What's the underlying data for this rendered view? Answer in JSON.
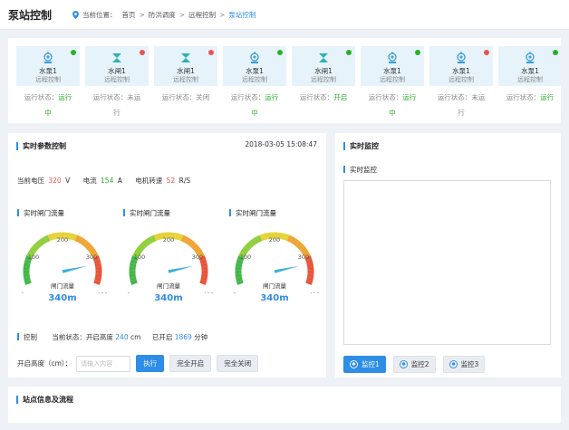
{
  "header": {
    "title": "泵站控制",
    "breadcrumb_label": "当前位置：",
    "breadcrumb": [
      "首页",
      "防洪调度",
      "远程控制",
      "泵站控制"
    ]
  },
  "pumps": [
    {
      "name": "水泵1",
      "sub": "远程控制",
      "status_label": "运行状态：",
      "status_a": "运行",
      "status_b": "中",
      "status_color": "green",
      "dot": "#2bae2b",
      "icon": "pump-icon"
    },
    {
      "name": "水闸1",
      "sub": "远程控制",
      "status_label": "运行状态：",
      "status_a": "未运",
      "status_b": "行",
      "status_color": "gray",
      "dot": "#e8554e",
      "icon": "sluice-gate-icon"
    },
    {
      "name": "水闸1",
      "sub": "远程控制",
      "status_label": "运行状态：",
      "status_a": "关闭",
      "status_b": "",
      "status_color": "gray",
      "dot": "#e8554e",
      "icon": "sluice-gate-icon"
    },
    {
      "name": "水泵1",
      "sub": "远程控制",
      "status_label": "运行状态：",
      "status_a": "运行",
      "status_b": "中",
      "status_color": "green",
      "dot": "#2bae2b",
      "icon": "pump-icon"
    },
    {
      "name": "水闸1",
      "sub": "远程控制",
      "status_label": "运行状态：",
      "status_a": "开启",
      "status_b": "",
      "status_color": "green",
      "dot": "#2bae2b",
      "icon": "sluice-gate-icon"
    },
    {
      "name": "水泵1",
      "sub": "远程控制",
      "status_label": "运行状态：",
      "status_a": "运行",
      "status_b": "中",
      "status_color": "green",
      "dot": "#2bae2b",
      "icon": "pump-icon"
    },
    {
      "name": "水泵1",
      "sub": "远程控制",
      "status_label": "运行状态：",
      "status_a": "未运",
      "status_b": "行",
      "status_color": "gray",
      "dot": "#e8554e",
      "icon": "pump-icon"
    },
    {
      "name": "水泵1",
      "sub": "远程控制",
      "status_label": "运行状态：",
      "status_a": "运行",
      "status_b": "",
      "status_color": "green",
      "dot": "#2bae2b",
      "icon": "pump-icon"
    }
  ],
  "params": {
    "title": "实时参数控制",
    "timestamp": "2018-03-05 15:08:47",
    "voltage_label": "当前电压",
    "voltage_value": "320",
    "voltage_unit": "V",
    "current_label": "电流",
    "current_value": "154",
    "current_unit": "A",
    "speed_label": "电机转速",
    "speed_value": "52",
    "speed_unit": "R/S",
    "gauges": [
      {
        "title": "实时闸门流量",
        "label": "闸门流量",
        "value": "340m",
        "reading": 340
      },
      {
        "title": "实时闸门流量",
        "label": "闸门流量",
        "value": "340m",
        "reading": 340
      },
      {
        "title": "实时闸门流量",
        "label": "闸门流量",
        "value": "340m",
        "reading": 340
      }
    ],
    "gauge_ticks": [
      "0",
      "100",
      "200",
      "300",
      "400"
    ],
    "control_label": "控制",
    "state_label": "当前状态：开启高度",
    "height_value": "240",
    "height_unit": "cm",
    "opened_label": "已开启",
    "opened_value": "1869",
    "opened_unit": "分钟",
    "open_height_label": "开启高度（cm）：",
    "input_placeholder": "请输入内容",
    "execute_btn": "执行",
    "full_open_btn": "完全开启",
    "full_close_btn": "完全关闭"
  },
  "monitor": {
    "title": "实时监控",
    "sub_title": "实时监控",
    "tabs": [
      "监控1",
      "监控2",
      "监控3"
    ]
  },
  "siteinfo": {
    "title": "站点信息及流程"
  },
  "colors": {
    "accent": "#2e8de6",
    "green": "#2bae2b",
    "red": "#e8554e"
  }
}
